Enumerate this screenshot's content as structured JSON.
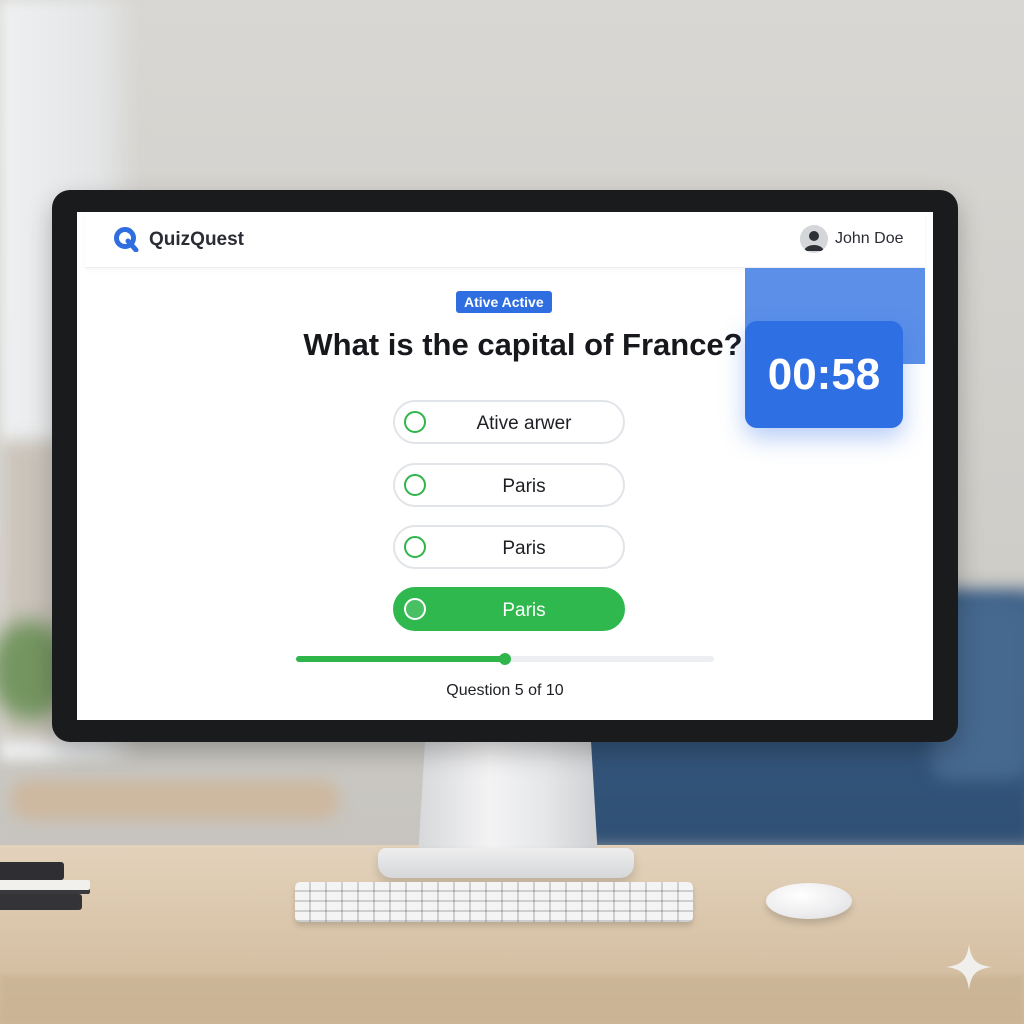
{
  "app": {
    "name": "QuizQuest",
    "logo_icon": "q-logo-icon",
    "accent": "#2e6ee0"
  },
  "user": {
    "name": "John Doe",
    "avatar_icon": "user-avatar-icon"
  },
  "quiz": {
    "badge": "Ative Active",
    "question": "What is the capital of France?",
    "options": [
      {
        "label": "Ative arwer",
        "selected": false
      },
      {
        "label": "Paris",
        "selected": false
      },
      {
        "label": "Paris",
        "selected": false
      },
      {
        "label": "Paris",
        "selected": true
      }
    ],
    "progress_text": "Question 5 of 10",
    "progress_fraction": 0.5,
    "timer": "00:58",
    "success_color": "#2fb54a",
    "timer_color": "#2f6fe4"
  }
}
